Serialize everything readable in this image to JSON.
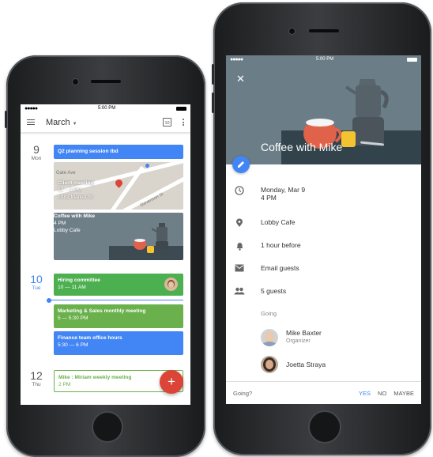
{
  "left": {
    "status": {
      "signal": "●●●●●",
      "time": "5:00 PM"
    },
    "toolbar": {
      "month": "March",
      "caret": "▼",
      "date_icon_day": "10"
    },
    "days": [
      {
        "num": "9",
        "dow": "Mon"
      },
      {
        "num": "10",
        "dow": "Tue"
      },
      {
        "num": "12",
        "dow": "Thu"
      }
    ],
    "events": {
      "q2": {
        "title": "Q2 planning session tbd"
      },
      "client": {
        "title": "Client meeting",
        "time": "12 – 3 PM",
        "location": "1082 Market St"
      },
      "map_labels": {
        "gate": "Gate Ave",
        "street": "Stevenson St"
      },
      "coffee": {
        "title": "Coffee with Mike",
        "time": "4 PM",
        "location": "Lobby Cafe"
      },
      "hiring": {
        "title": "Hiring committee",
        "time": "10 — 11 AM"
      },
      "marketing": {
        "title": "Marketing & Sales monthly meeting",
        "time": "5 — 5:30 PM"
      },
      "finance": {
        "title": "Finance team office hours",
        "time": "5:30 — 6 PM"
      },
      "mike": {
        "title": "Mike : Miriam weekly meeting",
        "time": "2 PM"
      }
    },
    "fab": "+"
  },
  "right": {
    "status": {
      "signal": "●●●●●",
      "time": "5:00 PM"
    },
    "close": "✕",
    "title": "Coffee with Mike",
    "date": "Monday, Mar 9",
    "time": "4 PM",
    "location": "Lobby Cafe",
    "reminder": "1 hour before",
    "email": "Email guests",
    "guests_count": "5 guests",
    "going_label": "Going",
    "guests": [
      {
        "name": "Mike Baxter",
        "role": "Organizer"
      },
      {
        "name": "Joetta Straya",
        "role": ""
      }
    ],
    "rsvp": {
      "question": "Going?",
      "yes": "YES",
      "no": "NO",
      "maybe": "MAYBE"
    }
  },
  "colors": {
    "blue": "#4285f4",
    "green": "#4caf50",
    "green2": "#6ab04c",
    "red": "#db4437",
    "hero": "#6b7d86"
  }
}
